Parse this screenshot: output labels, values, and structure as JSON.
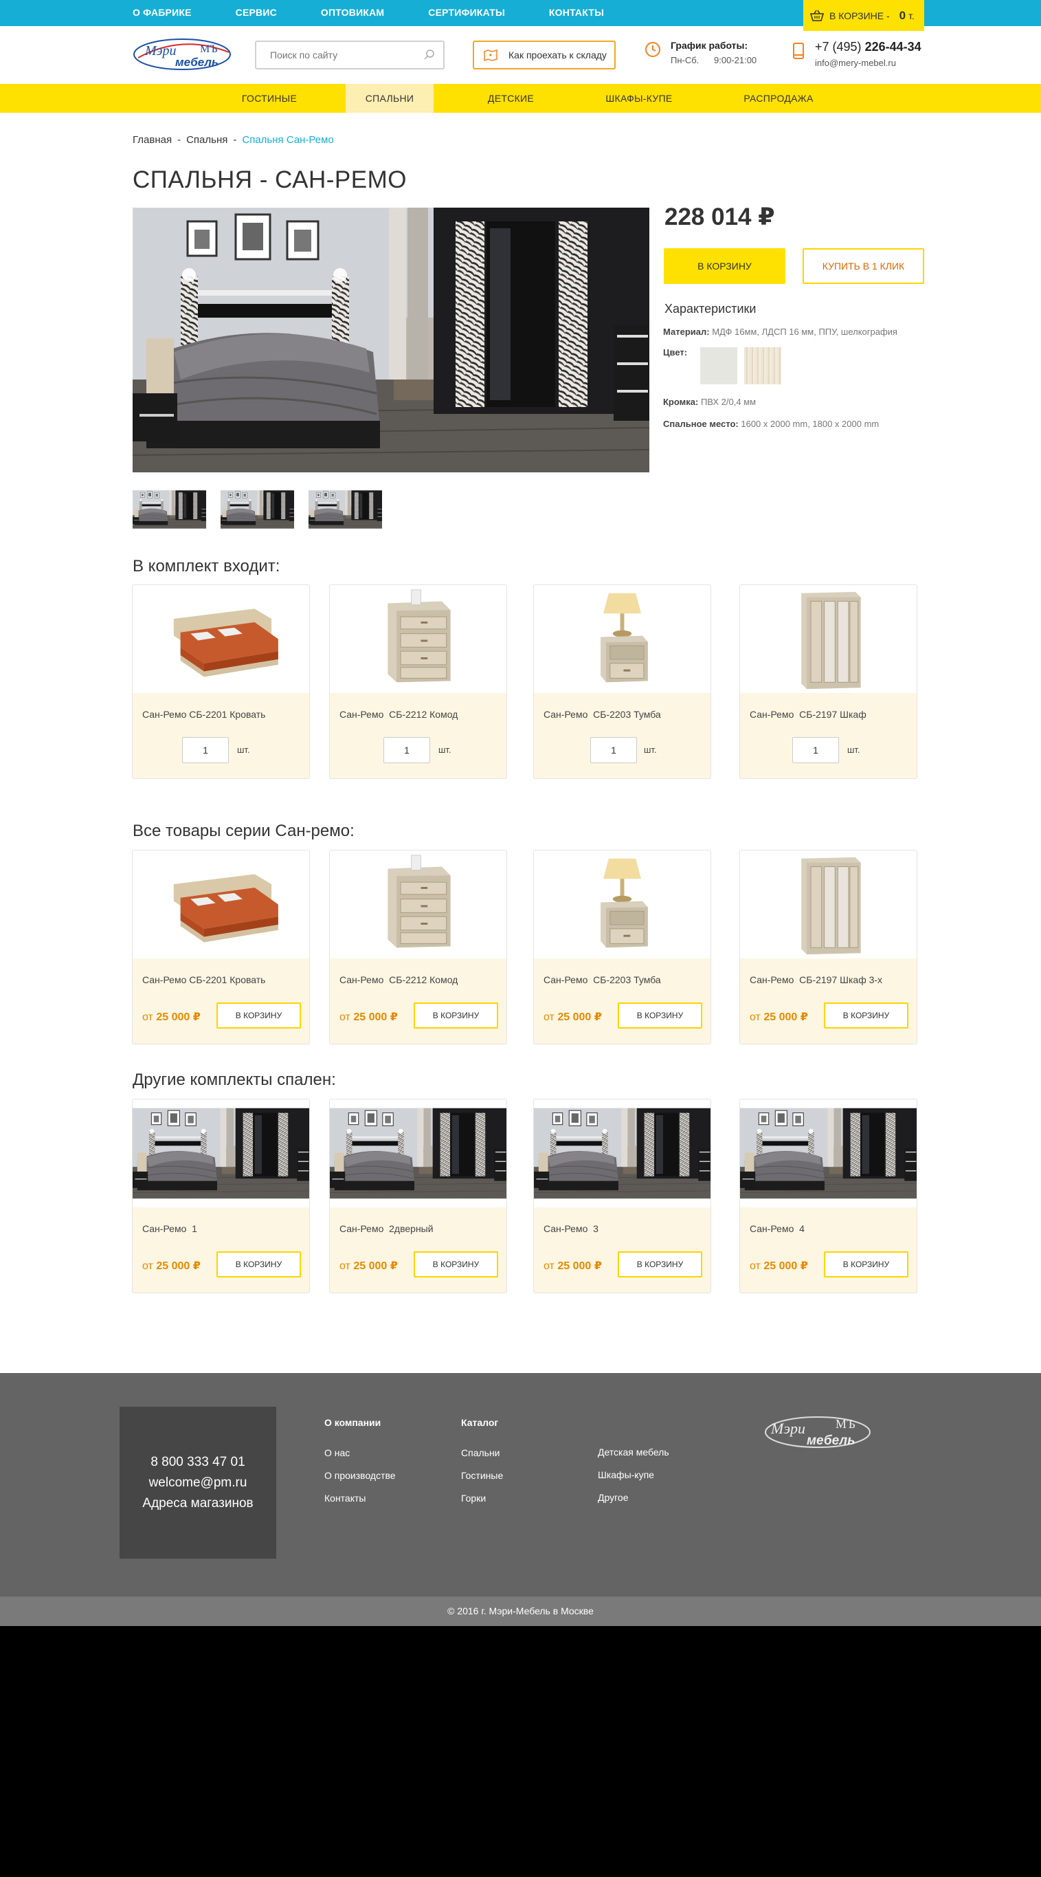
{
  "topnav": [
    "О ФАБРИКЕ",
    "СЕРВИС",
    "ОПТОВИКАМ",
    "СЕРТИФИКАТЫ",
    "КОНТАКТЫ"
  ],
  "cart": {
    "label": "В КОРЗИНЕ  -",
    "count": "0",
    "unit": "т."
  },
  "header": {
    "search_placeholder": "Поиск по сайту",
    "route_label": "Как проехать к складу",
    "hours_title": "График работы:",
    "hours_days": "Пн-Сб.",
    "hours_time": "9:00-21:00",
    "phone_prefix": "+7 (495)",
    "phone_number": "226-44-34",
    "email": "info@mery-mebel.ru",
    "logo_text_1": "Мэри",
    "logo_text_2": "мебель",
    "logo_mark": "МЪ"
  },
  "mainnav": [
    "ГОСТИНЫЕ",
    "СПАЛЬНИ",
    "ДЕТСКИЕ",
    "ШКАФЫ-КУПЕ",
    "РАСПРОДАЖА"
  ],
  "breadcrumb": [
    "Главная",
    "-",
    "Спальня",
    "-",
    "Спальня Сан-Ремо"
  ],
  "title": "СПАЛЬНЯ - САН-РЕМО",
  "product": {
    "price": "228 014 ₽",
    "btn_cart": "В КОРЗИНУ",
    "btn_1click": "КУПИТЬ В 1 КЛИК",
    "chars_title": "Характеристики",
    "material_label": "Материал:",
    "material_value": "МДФ 16мм, ЛДСП 16 мм, ППУ, шелкография",
    "color_label": "Цвет:",
    "edge_label": "Кромка:",
    "edge_value": "ПВХ 2/0,4 мм",
    "bed_label": "Спальное место:",
    "bed_value": "1600  х 2000 mm, 1800  х 2000 mm"
  },
  "kit": {
    "title": "В комплект входит:",
    "unit": "шт.",
    "items": [
      {
        "name": "Сан-Ремо СБ-2201 Кровать",
        "qty": "1"
      },
      {
        "name": "Сан-Ремо  СБ-2212 Комод",
        "qty": "1"
      },
      {
        "name": "Сан-Ремо  СБ-2203 Тумба",
        "qty": "1"
      },
      {
        "name": "Сан-Ремо  СБ-2197 Шкаф",
        "qty": "1"
      }
    ]
  },
  "series": {
    "title": "Все товары серии Сан-ремо:",
    "items": [
      {
        "name": "Сан-Ремо СБ-2201 Кровать",
        "price_prefix": "от",
        "price": "25 000 ₽",
        "btn": "В КОРЗИНУ"
      },
      {
        "name": "Сан-Ремо  СБ-2212 Комод",
        "price_prefix": "от",
        "price": "25 000 ₽",
        "btn": "В КОРЗИНУ"
      },
      {
        "name": "Сан-Ремо  СБ-2203 Тумба",
        "price_prefix": "от",
        "price": "25 000 ₽",
        "btn": "В КОРЗИНУ"
      },
      {
        "name": "Сан-Ремо  СБ-2197 Шкаф 3-х",
        "price_prefix": "от",
        "price": "25 000 ₽",
        "btn": "В КОРЗИНУ"
      }
    ]
  },
  "other": {
    "title": "Другие комплекты спален:",
    "items": [
      {
        "name": "Сан-Ремо  1",
        "price_prefix": "от",
        "price": "25 000 ₽",
        "btn": "В КОРЗИНУ"
      },
      {
        "name": "Сан-Ремо  2дверный",
        "price_prefix": "от",
        "price": "25 000 ₽",
        "btn": "В КОРЗИНУ"
      },
      {
        "name": "Сан-Ремо  3",
        "price_prefix": "от",
        "price": "25 000 ₽",
        "btn": "В КОРЗИНУ"
      },
      {
        "name": "Сан-Ремо  4",
        "price_prefix": "от",
        "price": "25 000 ₽",
        "btn": "В КОРЗИНУ"
      }
    ]
  },
  "footer": {
    "phone": "8 800 333 47 01",
    "email": "welcome@pm.ru",
    "stores": "Адреса магазинов",
    "company_title": "О компании",
    "company_links": [
      "О нас",
      "О производстве",
      "Контакты"
    ],
    "catalog_title": "Каталог",
    "catalog_links_1": [
      "Спальни",
      "Гостиные",
      "Горки"
    ],
    "catalog_links_2": [
      "Детская мебель",
      "Шкафы-купе",
      "Другое"
    ],
    "copyright": "© 2016 г. Мэри-Мебель в Москве"
  },
  "colors": {
    "accent": "#16aed4",
    "yellow": "#ffe100",
    "orange": "#e78a00",
    "footer": "#646464"
  }
}
